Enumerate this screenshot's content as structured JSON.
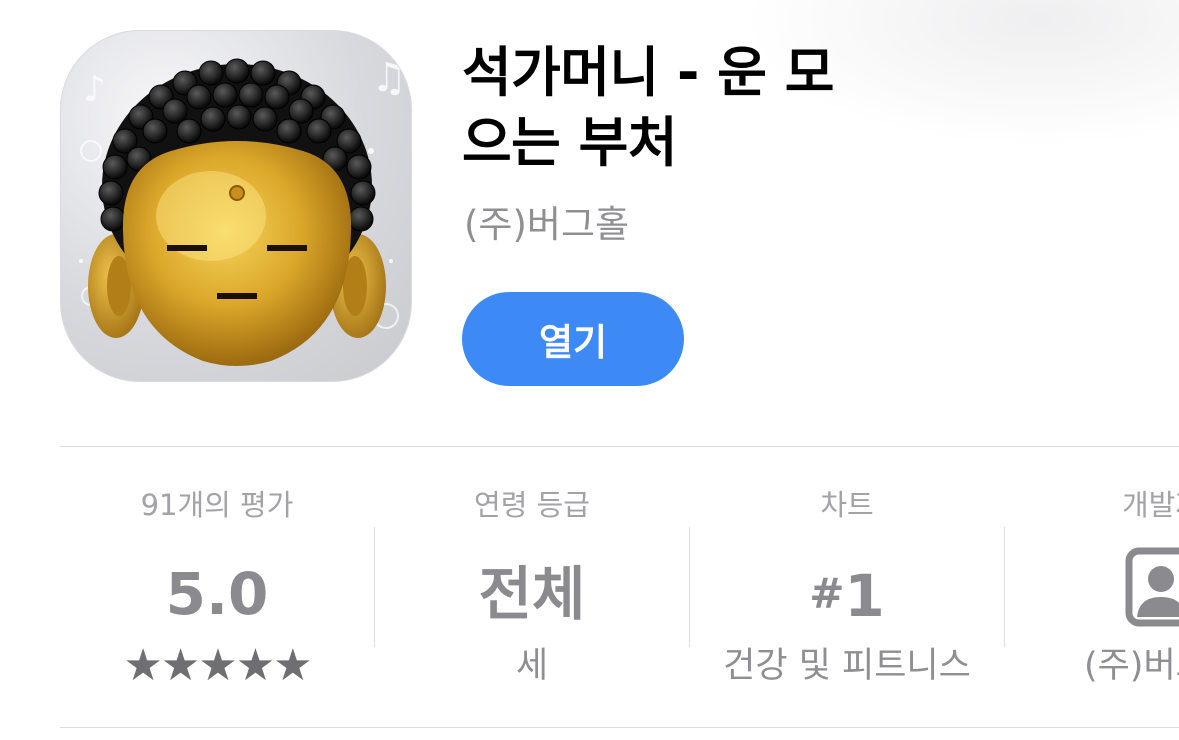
{
  "app": {
    "title": "석가머니 - 운 모으는 부처",
    "developer": "(주)버그홀",
    "open_button": "열기",
    "icon": "buddha-head-icon"
  },
  "info": {
    "ratings": {
      "label": "91개의 평가",
      "value": "5.0",
      "stars_display": "★★★★★",
      "stars": 5
    },
    "age": {
      "label": "연령 등급",
      "value": "전체",
      "sub": "세"
    },
    "chart": {
      "label": "차트",
      "hash": "#",
      "rank": "1",
      "category": "건강 및 피트니스"
    },
    "developer": {
      "label": "개발자",
      "icon": "person-square-icon",
      "name": "(주)버그홀"
    }
  },
  "colors": {
    "accent": "#3d8af7",
    "secondary_text": "#8e8e93",
    "divider": "#dedee2"
  }
}
